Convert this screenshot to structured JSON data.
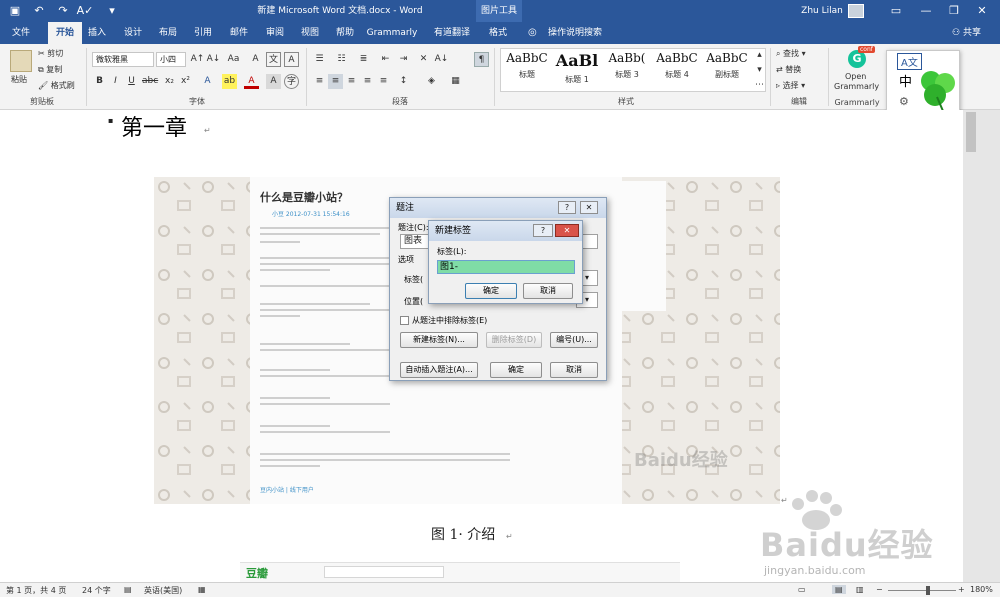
{
  "titlebar": {
    "document_title": "新建 Microsoft Word 文档.docx - Word",
    "context_tool": "图片工具",
    "user": "Zhu Lilan",
    "accent": "#2b579a"
  },
  "tabs": [
    "文件",
    "开始",
    "插入",
    "设计",
    "布局",
    "引用",
    "邮件",
    "审阅",
    "视图",
    "帮助",
    "Grammarly",
    "有道翻译",
    "格式"
  ],
  "tell_me": "操作说明搜索",
  "share": "共享",
  "clipboard": {
    "paste": "粘贴",
    "cut": "剪切",
    "copy": "复制",
    "format_painter": "格式刷",
    "group": "剪贴板"
  },
  "font": {
    "name": "微软雅黑",
    "size": "小四",
    "bold": "B",
    "italic": "I",
    "underline": "U",
    "group": "字体"
  },
  "paragraph": {
    "group": "段落"
  },
  "styles": {
    "items": [
      {
        "preview": "AaBbC",
        "name": "标题"
      },
      {
        "preview": "AaBl",
        "name": "标题 1"
      },
      {
        "preview": "AaBb(",
        "name": "标题 3"
      },
      {
        "preview": "AaBbC",
        "name": "标题 4"
      },
      {
        "preview": "AaBbC",
        "name": "副标题"
      }
    ],
    "group": "样式"
  },
  "editing": {
    "find": "查找",
    "replace": "替换",
    "select": "选择",
    "group": "编辑"
  },
  "grammarly": {
    "open": "Open",
    "name": "Grammarly",
    "group": "Grammarly",
    "badge": "conf"
  },
  "document": {
    "heading": "第一章",
    "caption": "图 1· 介绍",
    "article_title": "什么是豆瓣小站？",
    "article_author": "小豆 2012-07-31 15:54:16",
    "article_link": "豆内小站 | 线下用户"
  },
  "caption_dialog": {
    "title": "题注",
    "caption_label": "题注(C):",
    "caption_value": "图表",
    "options": "选项",
    "label_label": "标签(",
    "position_label": "位置(",
    "exclude_label": "从题注中排除标签(E)",
    "new_label_btn": "新建标签(N)...",
    "delete_label_btn": "删除标签(D)",
    "numbering_btn": "编号(U)...",
    "autocaption_btn": "自动插入题注(A)...",
    "ok": "确定",
    "cancel": "取消"
  },
  "new_label_dialog": {
    "title": "新建标签",
    "label": "标签(L):",
    "value": "图1-",
    "ok": "确定",
    "cancel": "取消",
    "highlight": "#7fdca6"
  },
  "ime": {
    "char": "中"
  },
  "status": {
    "page": "第 1 页，共 4 页",
    "words": "24 个字",
    "language": "英语(美国)",
    "zoom": "180%"
  },
  "watermark": {
    "brand": "Baidu经验",
    "url": "jingyan.baidu.com"
  }
}
